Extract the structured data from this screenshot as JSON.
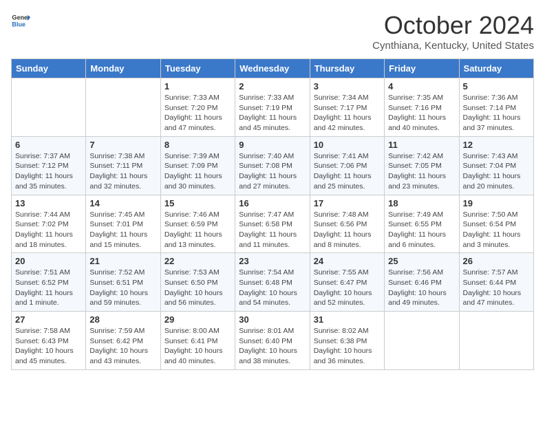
{
  "header": {
    "logo_general": "General",
    "logo_blue": "Blue",
    "month": "October 2024",
    "location": "Cynthiana, Kentucky, United States"
  },
  "days_of_week": [
    "Sunday",
    "Monday",
    "Tuesday",
    "Wednesday",
    "Thursday",
    "Friday",
    "Saturday"
  ],
  "weeks": [
    [
      {
        "num": "",
        "detail": ""
      },
      {
        "num": "",
        "detail": ""
      },
      {
        "num": "1",
        "detail": "Sunrise: 7:33 AM\nSunset: 7:20 PM\nDaylight: 11 hours and 47 minutes."
      },
      {
        "num": "2",
        "detail": "Sunrise: 7:33 AM\nSunset: 7:19 PM\nDaylight: 11 hours and 45 minutes."
      },
      {
        "num": "3",
        "detail": "Sunrise: 7:34 AM\nSunset: 7:17 PM\nDaylight: 11 hours and 42 minutes."
      },
      {
        "num": "4",
        "detail": "Sunrise: 7:35 AM\nSunset: 7:16 PM\nDaylight: 11 hours and 40 minutes."
      },
      {
        "num": "5",
        "detail": "Sunrise: 7:36 AM\nSunset: 7:14 PM\nDaylight: 11 hours and 37 minutes."
      }
    ],
    [
      {
        "num": "6",
        "detail": "Sunrise: 7:37 AM\nSunset: 7:12 PM\nDaylight: 11 hours and 35 minutes."
      },
      {
        "num": "7",
        "detail": "Sunrise: 7:38 AM\nSunset: 7:11 PM\nDaylight: 11 hours and 32 minutes."
      },
      {
        "num": "8",
        "detail": "Sunrise: 7:39 AM\nSunset: 7:09 PM\nDaylight: 11 hours and 30 minutes."
      },
      {
        "num": "9",
        "detail": "Sunrise: 7:40 AM\nSunset: 7:08 PM\nDaylight: 11 hours and 27 minutes."
      },
      {
        "num": "10",
        "detail": "Sunrise: 7:41 AM\nSunset: 7:06 PM\nDaylight: 11 hours and 25 minutes."
      },
      {
        "num": "11",
        "detail": "Sunrise: 7:42 AM\nSunset: 7:05 PM\nDaylight: 11 hours and 23 minutes."
      },
      {
        "num": "12",
        "detail": "Sunrise: 7:43 AM\nSunset: 7:04 PM\nDaylight: 11 hours and 20 minutes."
      }
    ],
    [
      {
        "num": "13",
        "detail": "Sunrise: 7:44 AM\nSunset: 7:02 PM\nDaylight: 11 hours and 18 minutes."
      },
      {
        "num": "14",
        "detail": "Sunrise: 7:45 AM\nSunset: 7:01 PM\nDaylight: 11 hours and 15 minutes."
      },
      {
        "num": "15",
        "detail": "Sunrise: 7:46 AM\nSunset: 6:59 PM\nDaylight: 11 hours and 13 minutes."
      },
      {
        "num": "16",
        "detail": "Sunrise: 7:47 AM\nSunset: 6:58 PM\nDaylight: 11 hours and 11 minutes."
      },
      {
        "num": "17",
        "detail": "Sunrise: 7:48 AM\nSunset: 6:56 PM\nDaylight: 11 hours and 8 minutes."
      },
      {
        "num": "18",
        "detail": "Sunrise: 7:49 AM\nSunset: 6:55 PM\nDaylight: 11 hours and 6 minutes."
      },
      {
        "num": "19",
        "detail": "Sunrise: 7:50 AM\nSunset: 6:54 PM\nDaylight: 11 hours and 3 minutes."
      }
    ],
    [
      {
        "num": "20",
        "detail": "Sunrise: 7:51 AM\nSunset: 6:52 PM\nDaylight: 11 hours and 1 minute."
      },
      {
        "num": "21",
        "detail": "Sunrise: 7:52 AM\nSunset: 6:51 PM\nDaylight: 10 hours and 59 minutes."
      },
      {
        "num": "22",
        "detail": "Sunrise: 7:53 AM\nSunset: 6:50 PM\nDaylight: 10 hours and 56 minutes."
      },
      {
        "num": "23",
        "detail": "Sunrise: 7:54 AM\nSunset: 6:48 PM\nDaylight: 10 hours and 54 minutes."
      },
      {
        "num": "24",
        "detail": "Sunrise: 7:55 AM\nSunset: 6:47 PM\nDaylight: 10 hours and 52 minutes."
      },
      {
        "num": "25",
        "detail": "Sunrise: 7:56 AM\nSunset: 6:46 PM\nDaylight: 10 hours and 49 minutes."
      },
      {
        "num": "26",
        "detail": "Sunrise: 7:57 AM\nSunset: 6:44 PM\nDaylight: 10 hours and 47 minutes."
      }
    ],
    [
      {
        "num": "27",
        "detail": "Sunrise: 7:58 AM\nSunset: 6:43 PM\nDaylight: 10 hours and 45 minutes."
      },
      {
        "num": "28",
        "detail": "Sunrise: 7:59 AM\nSunset: 6:42 PM\nDaylight: 10 hours and 43 minutes."
      },
      {
        "num": "29",
        "detail": "Sunrise: 8:00 AM\nSunset: 6:41 PM\nDaylight: 10 hours and 40 minutes."
      },
      {
        "num": "30",
        "detail": "Sunrise: 8:01 AM\nSunset: 6:40 PM\nDaylight: 10 hours and 38 minutes."
      },
      {
        "num": "31",
        "detail": "Sunrise: 8:02 AM\nSunset: 6:38 PM\nDaylight: 10 hours and 36 minutes."
      },
      {
        "num": "",
        "detail": ""
      },
      {
        "num": "",
        "detail": ""
      }
    ]
  ]
}
